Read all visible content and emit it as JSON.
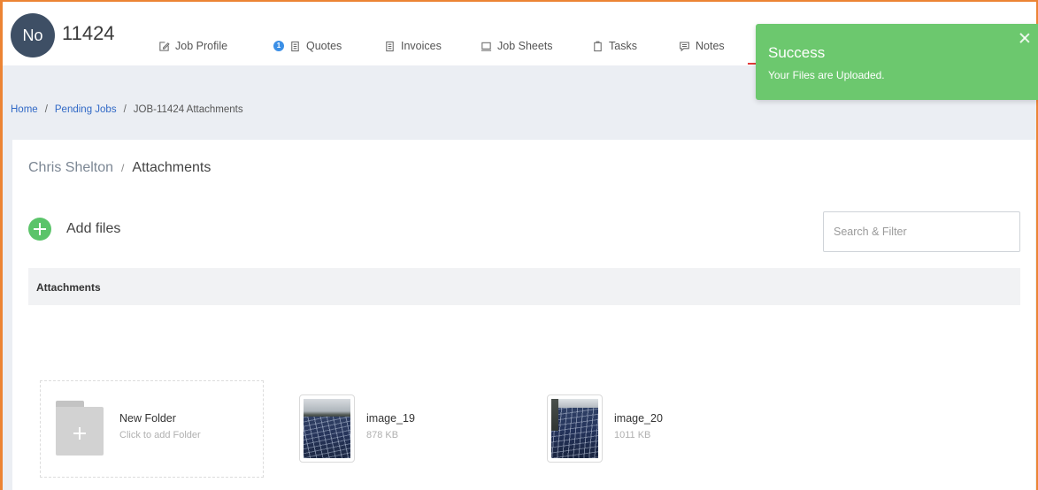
{
  "colors": {
    "frame_border": "#ec8434",
    "avatar_bg": "#3e4f65",
    "badge_bg": "#3b8fe6",
    "active_tab_underline": "#e23a3a",
    "toast_bg": "#6cc86e",
    "link": "#3169c6",
    "add_button": "#5bc46a"
  },
  "header": {
    "avatar_text": "No",
    "job_number": "11424",
    "nav": [
      {
        "label": "Job Profile",
        "icon": "edit-icon"
      },
      {
        "label": "Quotes",
        "icon": "document-icon",
        "badge": "1"
      },
      {
        "label": "Invoices",
        "icon": "document-icon"
      },
      {
        "label": "Job Sheets",
        "icon": "laptop-icon"
      },
      {
        "label": "Tasks",
        "icon": "clipboard-icon"
      },
      {
        "label": "Notes",
        "icon": "chat-icon"
      }
    ]
  },
  "toast": {
    "title": "Success",
    "message": "Your Files are Uploaded.",
    "close_icon": "close-icon"
  },
  "breadcrumb": {
    "separator": "/",
    "items": [
      {
        "label": "Home",
        "current": false
      },
      {
        "label": "Pending Jobs",
        "current": false
      },
      {
        "label": "JOB-11424 Attachments",
        "current": true
      }
    ]
  },
  "page_heading": {
    "client": "Chris Shelton",
    "separator": "/",
    "section": "Attachments"
  },
  "toolbar": {
    "add_icon": "plus-circle-icon",
    "add_files_label": "Add files",
    "search": {
      "placeholder": "Search & Filter",
      "value": ""
    }
  },
  "attachments": {
    "header": "Attachments",
    "new_folder": {
      "title": "New Folder",
      "hint": "Click to add Folder",
      "icon": "folder-plus-icon"
    },
    "files": [
      {
        "name": "image_19",
        "size": "878 KB"
      },
      {
        "name": "image_20",
        "size": "1011 KB"
      }
    ]
  }
}
